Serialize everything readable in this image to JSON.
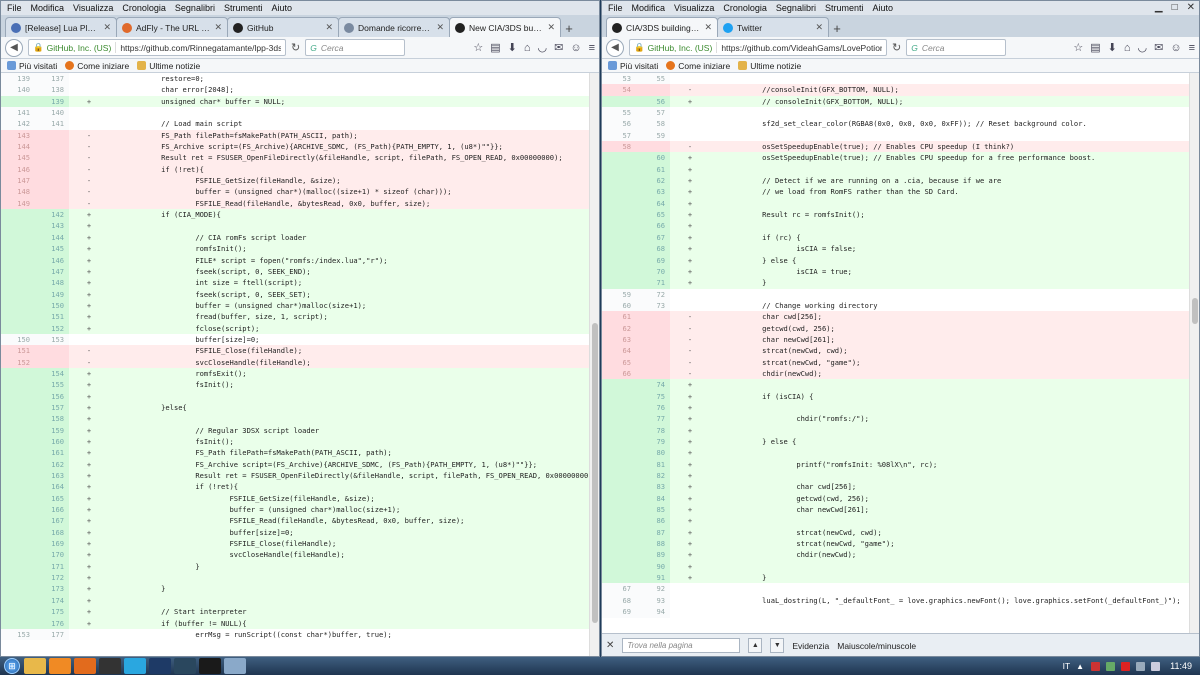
{
  "menu": [
    "File",
    "Modifica",
    "Visualizza",
    "Cronologia",
    "Segnalibri",
    "Strumenti",
    "Aiuto"
  ],
  "bookmarks": [
    "Più visitati",
    "Come iniziare",
    "Ultime notizie"
  ],
  "left": {
    "tabs": [
      {
        "title": "[Release] Lua Player ...",
        "fav": "lua-icon",
        "color": "#4a6fb5"
      },
      {
        "title": "AdFly - The URL sho...",
        "fav": "adfly-icon",
        "color": "#e06a2c"
      },
      {
        "title": "GitHub",
        "fav": "github-icon",
        "color": "#222222"
      },
      {
        "title": "Domande ricorrenti ...",
        "fav": "page-icon",
        "color": "#7a8aa0"
      },
      {
        "title": "New CIA/3DS builds...",
        "fav": "github-icon",
        "color": "#222222",
        "active": true
      }
    ],
    "identity": "GitHub, Inc. (US)",
    "url": "https://github.com/Rinnegatamante/lpp-3ds/c",
    "search_placeholder": "Cerca",
    "lines": [
      {
        "t": "ctx",
        "o": "139",
        "n": "137",
        "s": "",
        "c": "        restore=0;"
      },
      {
        "t": "ctx",
        "o": "140",
        "n": "138",
        "s": "",
        "c": "        char error[2048];"
      },
      {
        "t": "add",
        "o": "",
        "n": "139",
        "s": "+",
        "c": "        unsigned char* buffer = NULL;"
      },
      {
        "t": "ctx",
        "o": "141",
        "n": "140",
        "s": "",
        "c": ""
      },
      {
        "t": "ctx",
        "o": "142",
        "n": "141",
        "s": "",
        "c": "        // Load main script"
      },
      {
        "t": "del",
        "o": "143",
        "n": "",
        "s": "-",
        "c": "        FS_Path filePath=fsMakePath(PATH_ASCII, path);"
      },
      {
        "t": "del",
        "o": "144",
        "n": "",
        "s": "-",
        "c": "        FS_Archive script=(FS_Archive){ARCHIVE_SDMC, (FS_Path){PATH_EMPTY, 1, (u8*)\"\"}};"
      },
      {
        "t": "del",
        "o": "145",
        "n": "",
        "s": "-",
        "c": "        Result ret = FSUSER_OpenFileDirectly(&fileHandle, script, filePath, FS_OPEN_READ, 0x00000000);"
      },
      {
        "t": "del",
        "o": "146",
        "n": "",
        "s": "-",
        "c": "        if (!ret){"
      },
      {
        "t": "del",
        "o": "147",
        "n": "",
        "s": "-",
        "c": "                FSFILE_GetSize(fileHandle, &size);"
      },
      {
        "t": "del",
        "o": "148",
        "n": "",
        "s": "-",
        "c": "                buffer = (unsigned char*)(malloc((size+1) * sizeof (char)));"
      },
      {
        "t": "del",
        "o": "149",
        "n": "",
        "s": "-",
        "c": "                FSFILE_Read(fileHandle, &bytesRead, 0x0, buffer, size);"
      },
      {
        "t": "add",
        "o": "",
        "n": "142",
        "s": "+",
        "c": "        if (CIA_MODE){"
      },
      {
        "t": "add",
        "o": "",
        "n": "143",
        "s": "+",
        "c": ""
      },
      {
        "t": "add",
        "o": "",
        "n": "144",
        "s": "+",
        "c": "                // CIA romFs script loader"
      },
      {
        "t": "add",
        "o": "",
        "n": "145",
        "s": "+",
        "c": "                romfsInit();"
      },
      {
        "t": "add",
        "o": "",
        "n": "146",
        "s": "+",
        "c": "                FILE* script = fopen(\"romfs:/index.lua\",\"r\");"
      },
      {
        "t": "add",
        "o": "",
        "n": "147",
        "s": "+",
        "c": "                fseek(script, 0, SEEK_END);"
      },
      {
        "t": "add",
        "o": "",
        "n": "148",
        "s": "+",
        "c": "                int size = ftell(script);"
      },
      {
        "t": "add",
        "o": "",
        "n": "149",
        "s": "+",
        "c": "                fseek(script, 0, SEEK_SET);"
      },
      {
        "t": "add",
        "o": "",
        "n": "150",
        "s": "+",
        "c": "                buffer = (unsigned char*)malloc(size+1);"
      },
      {
        "t": "add",
        "o": "",
        "n": "151",
        "s": "+",
        "c": "                fread(buffer, size, 1, script);"
      },
      {
        "t": "add",
        "o": "",
        "n": "152",
        "s": "+",
        "c": "                fclose(script);"
      },
      {
        "t": "ctx",
        "o": "150",
        "n": "153",
        "s": "",
        "c": "                buffer[size]=0;"
      },
      {
        "t": "del",
        "o": "151",
        "n": "",
        "s": "-",
        "c": "                FSFILE_Close(fileHandle);"
      },
      {
        "t": "del",
        "o": "152",
        "n": "",
        "s": "-",
        "c": "                svcCloseHandle(fileHandle);"
      },
      {
        "t": "add",
        "o": "",
        "n": "154",
        "s": "+",
        "c": "                romfsExit();"
      },
      {
        "t": "add",
        "o": "",
        "n": "155",
        "s": "+",
        "c": "                fsInit();"
      },
      {
        "t": "add",
        "o": "",
        "n": "156",
        "s": "+",
        "c": ""
      },
      {
        "t": "add",
        "o": "",
        "n": "157",
        "s": "+",
        "c": "        }else{"
      },
      {
        "t": "add",
        "o": "",
        "n": "158",
        "s": "+",
        "c": ""
      },
      {
        "t": "add",
        "o": "",
        "n": "159",
        "s": "+",
        "c": "                // Regular 3DSX script loader"
      },
      {
        "t": "add",
        "o": "",
        "n": "160",
        "s": "+",
        "c": "                fsInit();"
      },
      {
        "t": "add",
        "o": "",
        "n": "161",
        "s": "+",
        "c": "                FS_Path filePath=fsMakePath(PATH_ASCII, path);"
      },
      {
        "t": "add",
        "o": "",
        "n": "162",
        "s": "+",
        "c": "                FS_Archive script=(FS_Archive){ARCHIVE_SDMC, (FS_Path){PATH_EMPTY, 1, (u8*)\"\"}};"
      },
      {
        "t": "add",
        "o": "",
        "n": "163",
        "s": "+",
        "c": "                Result ret = FSUSER_OpenFileDirectly(&fileHandle, script, filePath, FS_OPEN_READ, 0x00000000);"
      },
      {
        "t": "add",
        "o": "",
        "n": "164",
        "s": "+",
        "c": "                if (!ret){"
      },
      {
        "t": "add",
        "o": "",
        "n": "165",
        "s": "+",
        "c": "                        FSFILE_GetSize(fileHandle, &size);"
      },
      {
        "t": "add",
        "o": "",
        "n": "166",
        "s": "+",
        "c": "                        buffer = (unsigned char*)malloc(size+1);"
      },
      {
        "t": "add",
        "o": "",
        "n": "167",
        "s": "+",
        "c": "                        FSFILE_Read(fileHandle, &bytesRead, 0x0, buffer, size);"
      },
      {
        "t": "add",
        "o": "",
        "n": "168",
        "s": "+",
        "c": "                        buffer[size]=0;"
      },
      {
        "t": "add",
        "o": "",
        "n": "169",
        "s": "+",
        "c": "                        FSFILE_Close(fileHandle);"
      },
      {
        "t": "add",
        "o": "",
        "n": "170",
        "s": "+",
        "c": "                        svcCloseHandle(fileHandle);"
      },
      {
        "t": "add",
        "o": "",
        "n": "171",
        "s": "+",
        "c": "                }"
      },
      {
        "t": "add",
        "o": "",
        "n": "172",
        "s": "+",
        "c": ""
      },
      {
        "t": "add",
        "o": "",
        "n": "173",
        "s": "+",
        "c": "        }"
      },
      {
        "t": "add",
        "o": "",
        "n": "174",
        "s": "+",
        "c": ""
      },
      {
        "t": "add",
        "o": "",
        "n": "175",
        "s": "+",
        "c": "        // Start interpreter"
      },
      {
        "t": "add",
        "o": "",
        "n": "176",
        "s": "+",
        "c": "        if (buffer != NULL){"
      },
      {
        "t": "ctx",
        "o": "153",
        "n": "177",
        "s": "",
        "c": "                errMsg = runScript((const char*)buffer, true);"
      }
    ]
  },
  "right": {
    "tabs": [
      {
        "title": "CIA/3DS building - Videah...",
        "fav": "github-icon",
        "color": "#222222",
        "active": true
      },
      {
        "title": "Twitter",
        "fav": "twitter-icon",
        "color": "#1da1f2"
      }
    ],
    "identity": "GitHub, Inc. (US)",
    "url": "https://github.com/VideahGams/LovePotion/c",
    "search_placeholder": "Cerca",
    "lines": [
      {
        "t": "ctx",
        "o": "53",
        "n": "55",
        "s": "",
        "c": ""
      },
      {
        "t": "del",
        "o": "54",
        "n": "",
        "s": "-",
        "c": "        //consoleInit(GFX_BOTTOM, NULL);"
      },
      {
        "t": "add",
        "o": "",
        "n": "56",
        "s": "+",
        "c": "        // consoleInit(GFX_BOTTOM, NULL);"
      },
      {
        "t": "ctx",
        "o": "55",
        "n": "57",
        "s": "",
        "c": ""
      },
      {
        "t": "ctx",
        "o": "56",
        "n": "58",
        "s": "",
        "c": "        sf2d_set_clear_color(RGBA8(0x0, 0x0, 0x0, 0xFF)); // Reset background color."
      },
      {
        "t": "ctx",
        "o": "57",
        "n": "59",
        "s": "",
        "c": ""
      },
      {
        "t": "del",
        "o": "58",
        "n": "",
        "s": "-",
        "c": "        osSetSpeedupEnable(true); // Enables CPU speedup (I think?)"
      },
      {
        "t": "add",
        "o": "",
        "n": "60",
        "s": "+",
        "c": "        osSetSpeedupEnable(true); // Enables CPU speedup for a free performance boost."
      },
      {
        "t": "add",
        "o": "",
        "n": "61",
        "s": "+",
        "c": ""
      },
      {
        "t": "add",
        "o": "",
        "n": "62",
        "s": "+",
        "c": "        // Detect if we are running on a .cia, because if we are"
      },
      {
        "t": "add",
        "o": "",
        "n": "63",
        "s": "+",
        "c": "        // we load from RomFS rather than the SD Card."
      },
      {
        "t": "add",
        "o": "",
        "n": "64",
        "s": "+",
        "c": ""
      },
      {
        "t": "add",
        "o": "",
        "n": "65",
        "s": "+",
        "c": "        Result rc = romfsInit();"
      },
      {
        "t": "add",
        "o": "",
        "n": "66",
        "s": "+",
        "c": ""
      },
      {
        "t": "add",
        "o": "",
        "n": "67",
        "s": "+",
        "c": "        if (rc) {"
      },
      {
        "t": "add",
        "o": "",
        "n": "68",
        "s": "+",
        "c": "                isCIA = false;"
      },
      {
        "t": "add",
        "o": "",
        "n": "69",
        "s": "+",
        "c": "        } else {"
      },
      {
        "t": "add",
        "o": "",
        "n": "70",
        "s": "+",
        "c": "                isCIA = true;"
      },
      {
        "t": "add",
        "o": "",
        "n": "71",
        "s": "+",
        "c": "        }"
      },
      {
        "t": "ctx",
        "o": "59",
        "n": "72",
        "s": "",
        "c": ""
      },
      {
        "t": "ctx",
        "o": "60",
        "n": "73",
        "s": "",
        "c": "        // Change working directory"
      },
      {
        "t": "del",
        "o": "61",
        "n": "",
        "s": "-",
        "c": "        char cwd[256];"
      },
      {
        "t": "del",
        "o": "62",
        "n": "",
        "s": "-",
        "c": "        getcwd(cwd, 256);"
      },
      {
        "t": "del",
        "o": "63",
        "n": "",
        "s": "-",
        "c": "        char newCwd[261];"
      },
      {
        "t": "del",
        "o": "64",
        "n": "",
        "s": "-",
        "c": "        strcat(newCwd, cwd);"
      },
      {
        "t": "del",
        "o": "65",
        "n": "",
        "s": "-",
        "c": "        strcat(newCwd, \"game\");"
      },
      {
        "t": "del",
        "o": "66",
        "n": "",
        "s": "-",
        "c": "        chdir(newCwd);"
      },
      {
        "t": "add",
        "o": "",
        "n": "74",
        "s": "+",
        "c": ""
      },
      {
        "t": "add",
        "o": "",
        "n": "75",
        "s": "+",
        "c": "        if (isCIA) {"
      },
      {
        "t": "add",
        "o": "",
        "n": "76",
        "s": "+",
        "c": ""
      },
      {
        "t": "add",
        "o": "",
        "n": "77",
        "s": "+",
        "c": "                chdir(\"romfs:/\");"
      },
      {
        "t": "add",
        "o": "",
        "n": "78",
        "s": "+",
        "c": ""
      },
      {
        "t": "add",
        "o": "",
        "n": "79",
        "s": "+",
        "c": "        } else {"
      },
      {
        "t": "add",
        "o": "",
        "n": "80",
        "s": "+",
        "c": ""
      },
      {
        "t": "add",
        "o": "",
        "n": "81",
        "s": "+",
        "c": "                printf(\"romfsInit: %08lX\\n\", rc);"
      },
      {
        "t": "add",
        "o": "",
        "n": "82",
        "s": "+",
        "c": ""
      },
      {
        "t": "add",
        "o": "",
        "n": "83",
        "s": "+",
        "c": "                char cwd[256];"
      },
      {
        "t": "add",
        "o": "",
        "n": "84",
        "s": "+",
        "c": "                getcwd(cwd, 256);"
      },
      {
        "t": "add",
        "o": "",
        "n": "85",
        "s": "+",
        "c": "                char newCwd[261];"
      },
      {
        "t": "add",
        "o": "",
        "n": "86",
        "s": "+",
        "c": ""
      },
      {
        "t": "add",
        "o": "",
        "n": "87",
        "s": "+",
        "c": "                strcat(newCwd, cwd);"
      },
      {
        "t": "add",
        "o": "",
        "n": "88",
        "s": "+",
        "c": "                strcat(newCwd, \"game\");"
      },
      {
        "t": "add",
        "o": "",
        "n": "89",
        "s": "+",
        "c": "                chdir(newCwd);"
      },
      {
        "t": "add",
        "o": "",
        "n": "90",
        "s": "+",
        "c": ""
      },
      {
        "t": "add",
        "o": "",
        "n": "91",
        "s": "+",
        "c": "        }"
      },
      {
        "t": "ctx",
        "o": "67",
        "n": "92",
        "s": "",
        "c": ""
      },
      {
        "t": "ctx",
        "o": "68",
        "n": "93",
        "s": "",
        "c": "        luaL_dostring(L, \"_defaultFont_ = love.graphics.newFont(); love.graphics.setFont(_defaultFont_)\");"
      },
      {
        "t": "ctx",
        "o": "69",
        "n": "94",
        "s": "",
        "c": ""
      }
    ],
    "findbar": {
      "placeholder": "Trova nella pagina",
      "highlight": "Evidenzia",
      "match_case": "Maiuscole/minuscole"
    }
  },
  "taskbar": {
    "language": "IT",
    "clock": "11:49",
    "apps": [
      {
        "name": "explorer-icon",
        "color": "#e8b84a"
      },
      {
        "name": "media-player-icon",
        "color": "#f08a24"
      },
      {
        "name": "firefox-icon",
        "color": "#e26b1d"
      },
      {
        "name": "terminal-icon",
        "color": "#333333"
      },
      {
        "name": "skype-icon",
        "color": "#2aa7e0"
      },
      {
        "name": "photoshop-icon",
        "color": "#1e3a66"
      },
      {
        "name": "steam-icon",
        "color": "#2a475e"
      },
      {
        "name": "cmd-icon",
        "color": "#1a1a1a"
      },
      {
        "name": "notepad-icon",
        "color": "#8aa9c9"
      }
    ]
  }
}
